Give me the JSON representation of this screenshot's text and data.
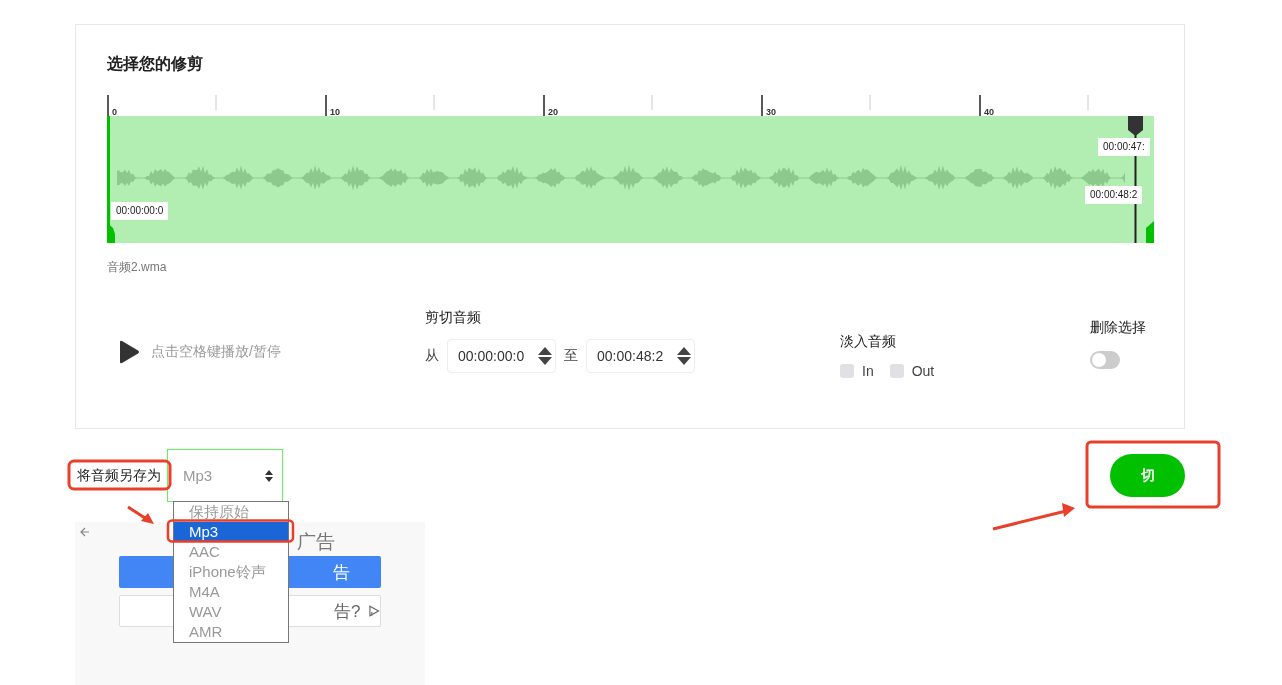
{
  "title": "选择您的修剪",
  "timeline": {
    "ticks": [
      {
        "label": "0"
      },
      {
        "label": "10"
      },
      {
        "label": "20"
      },
      {
        "label": "30"
      },
      {
        "label": "40"
      }
    ],
    "start_label": "00:00:00:0",
    "playhead_label": "00:00:47:",
    "end_label": "00:00:48:2"
  },
  "file_name": "音频2.wma",
  "play": {
    "hint": "点击空格键播放/暂停"
  },
  "trim": {
    "heading": "剪切音频",
    "from_label": "从",
    "from_value": "00:00:00:0",
    "to_label": "至",
    "to_value": "00:00:48:2"
  },
  "fade": {
    "heading": "淡入音频",
    "options": [
      {
        "label": "In",
        "checked": false
      },
      {
        "label": "Out",
        "checked": false
      }
    ]
  },
  "delete_selection": {
    "heading": "删除选择",
    "on": false
  },
  "save_as": {
    "label": "将音频另存为",
    "value": "Mp3",
    "options": [
      {
        "label": "保持原始",
        "selected": false
      },
      {
        "label": "Mp3",
        "selected": true
      },
      {
        "label": "AAC",
        "selected": false
      },
      {
        "label": "iPhone铃声",
        "selected": false
      },
      {
        "label": "M4A",
        "selected": false
      },
      {
        "label": "WAV",
        "selected": false
      },
      {
        "label": "AMR",
        "selected": false
      }
    ]
  },
  "cut_button": "切",
  "ad": {
    "title_fragment": "广告",
    "primary_fragment": "告",
    "secondary_fragment": "告?"
  }
}
